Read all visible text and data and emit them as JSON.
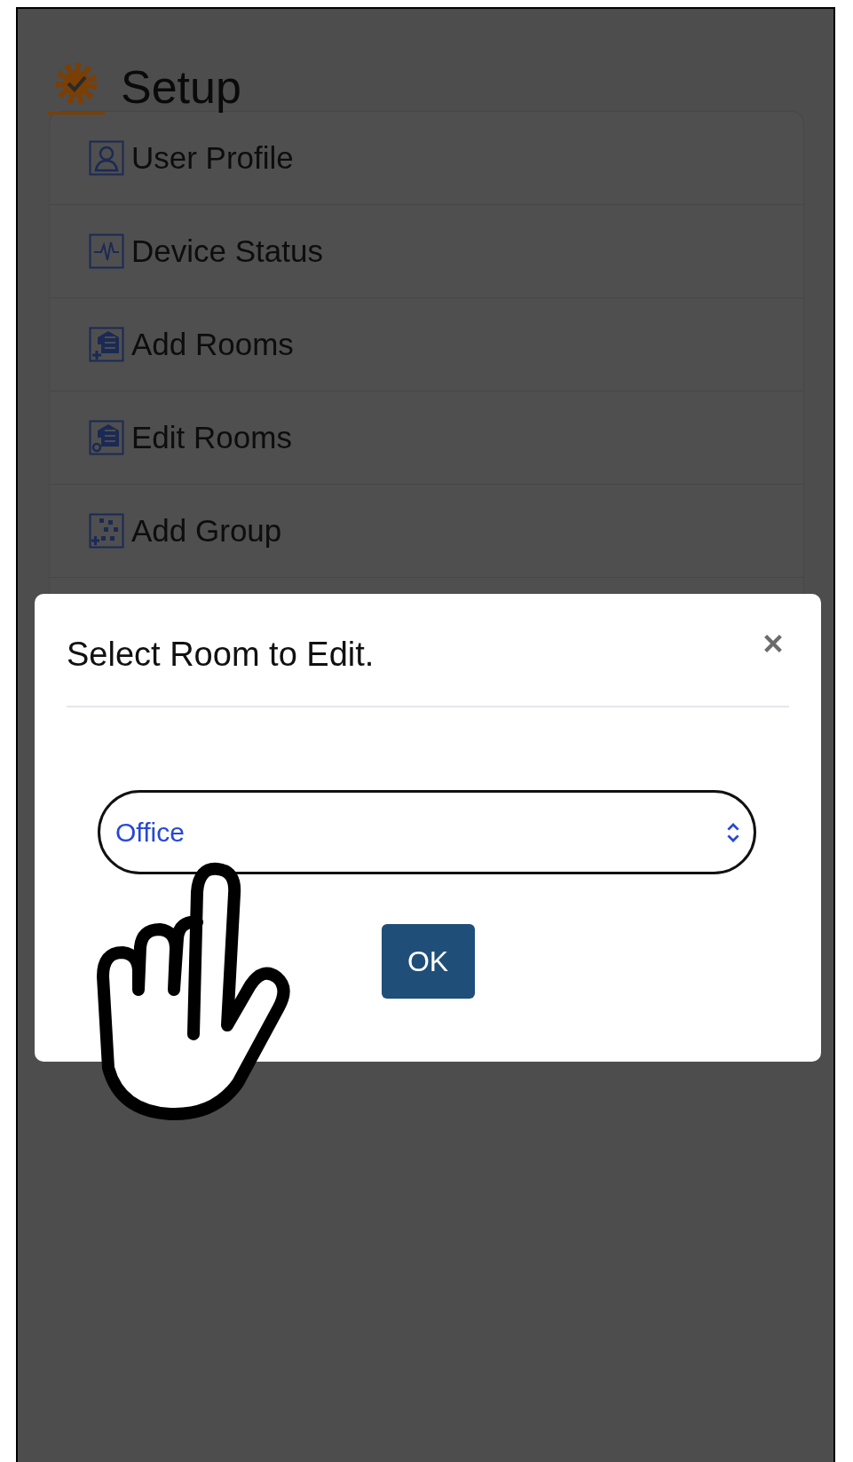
{
  "header": {
    "title": "Setup"
  },
  "menu": [
    {
      "label": "User Profile",
      "kind": "user"
    },
    {
      "label": "Device Status",
      "kind": "pulse"
    },
    {
      "label": "Add Rooms",
      "kind": "rooms-add"
    },
    {
      "label": "Edit Rooms",
      "kind": "rooms-edit"
    },
    {
      "label": "Add Group",
      "kind": "group-add"
    }
  ],
  "dialog": {
    "title": "Select Room to Edit.",
    "select": {
      "value": "Office"
    },
    "button": "OK"
  }
}
